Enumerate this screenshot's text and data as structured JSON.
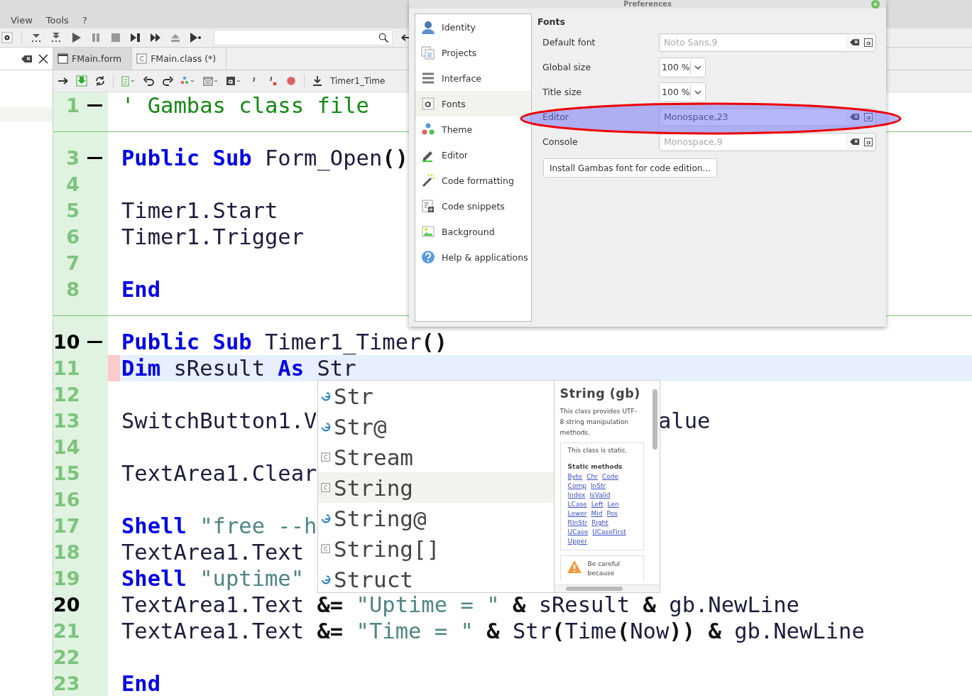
{
  "menu": [
    {
      "label": "View"
    },
    {
      "label": "Tools"
    },
    {
      "label": "?"
    }
  ],
  "tabs": [
    {
      "label": "FMain.form",
      "selected": false
    },
    {
      "label": "FMain.class (*)",
      "selected": true
    }
  ],
  "procedure": "Timer1_Time",
  "editor": {
    "lines": [
      {
        "kind": "code",
        "number": "1",
        "fold": true,
        "marked": false,
        "tokens": [
          {
            "kind": "com",
            "text": "' Gambas class file"
          }
        ]
      },
      {
        "kind": "separator"
      },
      {
        "kind": "code",
        "number": "3",
        "fold": true,
        "marked": false,
        "tokens": [
          {
            "kind": "kw",
            "text": "Public Sub"
          },
          {
            "kind": "id",
            "text": " Form_Open"
          },
          {
            "kind": "op",
            "text": "()"
          }
        ]
      },
      {
        "kind": "code",
        "number": "4",
        "marked": false
      },
      {
        "kind": "code",
        "number": "5",
        "marked": false,
        "tokens": [
          {
            "kind": "id",
            "text": "Timer1.Start"
          }
        ]
      },
      {
        "kind": "code",
        "number": "6",
        "marked": false,
        "tokens": [
          {
            "kind": "id",
            "text": "Timer1.Trigger"
          }
        ]
      },
      {
        "kind": "code",
        "number": "7",
        "marked": false
      },
      {
        "kind": "code",
        "number": "8",
        "marked": false,
        "tokens": [
          {
            "kind": "kw",
            "text": "End"
          }
        ]
      },
      {
        "kind": "separator"
      },
      {
        "kind": "code",
        "number": "10",
        "fold": true,
        "marked": true,
        "tokens": [
          {
            "kind": "kw",
            "text": "Public Sub"
          },
          {
            "kind": "id",
            "text": " Timer1_Timer"
          },
          {
            "kind": "op",
            "text": "()"
          }
        ]
      },
      {
        "kind": "code",
        "number": "11",
        "marked": false,
        "current": true,
        "tokens": [
          {
            "kind": "kw",
            "text": "Dim"
          },
          {
            "kind": "id",
            "text": " sResult "
          },
          {
            "kind": "kw",
            "text": "As"
          },
          {
            "kind": "id",
            "text": " Str"
          }
        ]
      },
      {
        "kind": "code",
        "number": "12",
        "marked": false
      },
      {
        "kind": "code",
        "number": "13",
        "marked": false,
        "tokens": [
          {
            "kind": "id",
            "text": "SwitchButton1.V"
          }
        ],
        "tail": "alue"
      },
      {
        "kind": "code",
        "number": "14",
        "marked": false
      },
      {
        "kind": "code",
        "number": "15",
        "marked": false,
        "tokens": [
          {
            "kind": "id",
            "text": "TextArea1.Clear"
          }
        ]
      },
      {
        "kind": "code",
        "number": "16",
        "marked": false
      },
      {
        "kind": "code",
        "number": "17",
        "marked": false,
        "tokens": [
          {
            "kind": "kw",
            "text": "Shell"
          },
          {
            "kind": "str",
            "text": " \"free --h"
          }
        ]
      },
      {
        "kind": "code",
        "number": "18",
        "marked": false,
        "tokens": [
          {
            "kind": "id",
            "text": "TextArea1.Text"
          }
        ]
      },
      {
        "kind": "code",
        "number": "19",
        "marked": false,
        "tokens": [
          {
            "kind": "kw",
            "text": "Shell"
          },
          {
            "kind": "str",
            "text": " \"uptime\""
          }
        ]
      },
      {
        "kind": "code",
        "number": "20",
        "marked": true,
        "tokens": [
          {
            "kind": "id",
            "text": "TextArea1.Text "
          },
          {
            "kind": "op",
            "text": "&="
          },
          {
            "kind": "str",
            "text": " \"Uptime = \" "
          },
          {
            "kind": "op",
            "text": "&"
          },
          {
            "kind": "id",
            "text": " sResult "
          },
          {
            "kind": "op",
            "text": "&"
          },
          {
            "kind": "id",
            "text": " gb.NewLine"
          }
        ]
      },
      {
        "kind": "code",
        "number": "21",
        "marked": false,
        "tokens": [
          {
            "kind": "id",
            "text": "TextArea1.Text "
          },
          {
            "kind": "op",
            "text": "&="
          },
          {
            "kind": "str",
            "text": " \"Time = \" "
          },
          {
            "kind": "op",
            "text": "&"
          },
          {
            "kind": "id",
            "text": " Str"
          },
          {
            "kind": "op",
            "text": "("
          },
          {
            "kind": "id",
            "text": "Time"
          },
          {
            "kind": "op",
            "text": "("
          },
          {
            "kind": "id",
            "text": "Now"
          },
          {
            "kind": "op",
            "text": "))"
          },
          {
            "kind": "op",
            "text": " &"
          },
          {
            "kind": "id",
            "text": " gb.NewLine"
          }
        ]
      },
      {
        "kind": "code",
        "number": "22",
        "marked": false
      },
      {
        "kind": "code",
        "number": "23",
        "marked": false,
        "tokens": [
          {
            "kind": "kw",
            "text": "End"
          }
        ]
      }
    ]
  },
  "completion": {
    "items": [
      {
        "label": "Str",
        "kind": "function",
        "selected": false
      },
      {
        "label": "Str@",
        "kind": "function",
        "selected": false
      },
      {
        "label": "Stream",
        "kind": "class",
        "selected": false
      },
      {
        "label": "String",
        "kind": "class",
        "selected": true
      },
      {
        "label": "String@",
        "kind": "function",
        "selected": false
      },
      {
        "label": "String[]",
        "kind": "class",
        "selected": false
      },
      {
        "label": "Struct",
        "kind": "function",
        "selected": false
      }
    ],
    "info": {
      "title": "String (gb)",
      "description": "This class provides UTF-8 string manipulation methods.",
      "note": "This class is static.",
      "methods_heading": "Static methods",
      "method_rows": [
        [
          "Byte",
          "Chr",
          "Code"
        ],
        [
          "Comp",
          "InStr"
        ],
        [
          "Index",
          "IsValid"
        ],
        [
          "LCase",
          "Left",
          "Len"
        ],
        [
          "Lower",
          "Mid",
          "Pos"
        ],
        [
          "RInStr",
          "Right"
        ],
        [
          "UCase",
          "UCaseFirst"
        ],
        [
          "Upper"
        ]
      ],
      "warning": "Be careful because"
    }
  },
  "preferences": {
    "title": "Preferences",
    "nav": [
      {
        "label": "Identity",
        "selected": false
      },
      {
        "label": "Projects",
        "selected": false
      },
      {
        "label": "Interface",
        "selected": false
      },
      {
        "label": "Fonts",
        "selected": true
      },
      {
        "label": "Theme",
        "selected": false
      },
      {
        "label": "Editor",
        "selected": false
      },
      {
        "label": "Code formatting",
        "selected": false
      },
      {
        "label": "Code snippets",
        "selected": false
      },
      {
        "label": "Background",
        "selected": false
      },
      {
        "label": "Help & applications",
        "selected": false
      }
    ],
    "section": "Fonts",
    "fields": [
      {
        "label": "Default font",
        "kind": "font",
        "placeholder": "Noto Sans,9"
      },
      {
        "label": "Global size",
        "kind": "size",
        "value": "100 %"
      },
      {
        "label": "Title size",
        "kind": "size",
        "value": "100 %"
      },
      {
        "label": "Editor",
        "kind": "font",
        "value": "Monospace,23",
        "highlighted": true
      },
      {
        "label": "Console",
        "kind": "font",
        "placeholder": "Monospace,9"
      }
    ],
    "button": "Install Gambas font for code edition..."
  }
}
